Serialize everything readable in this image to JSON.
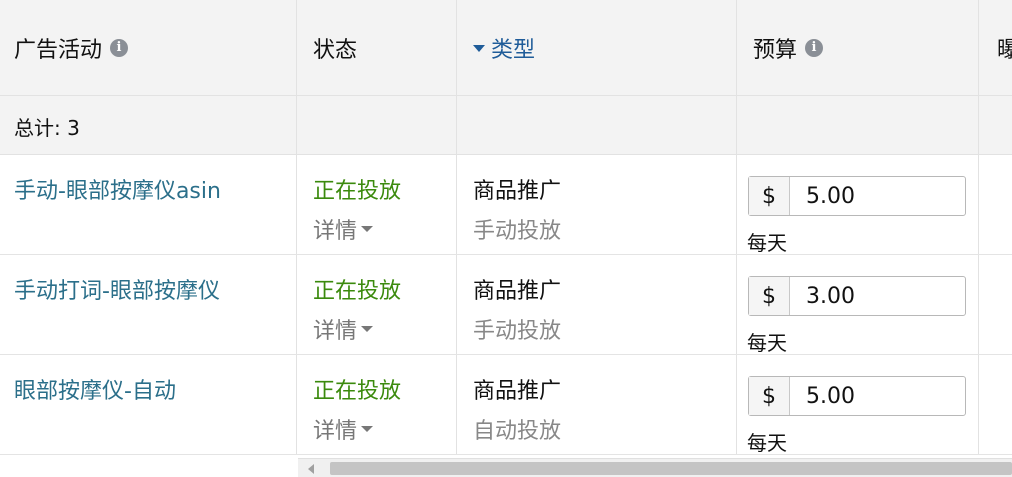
{
  "header": {
    "campaign": "广告活动",
    "status": "状态",
    "type": "类型",
    "budget": "预算",
    "next_partial": "曝"
  },
  "totals": {
    "label": "总计: 3"
  },
  "rows": [
    {
      "campaign": "手动-眼部按摩仪asin",
      "status": "正在投放",
      "details": "详情",
      "type": "商品推广",
      "targeting": "手动投放",
      "currency": "$",
      "budget": "5.00",
      "period": "每天"
    },
    {
      "campaign": "手动打词-眼部按摩仪",
      "status": "正在投放",
      "details": "详情",
      "type": "商品推广",
      "targeting": "手动投放",
      "currency": "$",
      "budget": "3.00",
      "period": "每天"
    },
    {
      "campaign": "眼部按摩仪-自动",
      "status": "正在投放",
      "details": "详情",
      "type": "商品推广",
      "targeting": "自动投放",
      "currency": "$",
      "budget": "5.00",
      "period": "每天"
    }
  ],
  "icons": {
    "info": "info-icon",
    "sort": "caret-down-icon",
    "details_toggle": "caret-down-icon",
    "scroll_left": "chevron-left-icon"
  },
  "colors": {
    "link": "#2b6f8a",
    "sort_header": "#1f5c99",
    "status_active": "#3b8a0d",
    "muted": "#888888",
    "header_bg": "#f3f3f3"
  }
}
